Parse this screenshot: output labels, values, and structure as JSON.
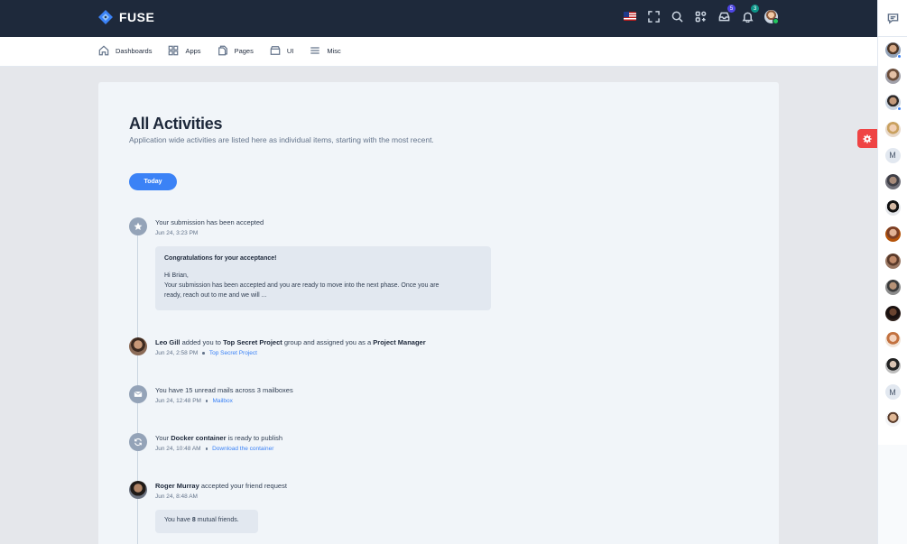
{
  "app": {
    "name": "FUSE"
  },
  "header": {
    "notifications_badge": "5",
    "alerts_badge": "3"
  },
  "nav": {
    "items": [
      {
        "label": "Dashboards",
        "icon": "home-icon"
      },
      {
        "label": "Apps",
        "icon": "grid-icon"
      },
      {
        "label": "Pages",
        "icon": "pages-icon"
      },
      {
        "label": "UI",
        "icon": "package-icon"
      },
      {
        "label": "Misc",
        "icon": "menu-icon"
      }
    ]
  },
  "main": {
    "title": "All Activities",
    "subtitle": "Application wide activities are listed here as individual items, starting with the most recent.",
    "filter_label": "Today"
  },
  "activities": [
    {
      "text": "Your submission has been accepted",
      "time": "Jun 24, 3:23 PM",
      "icon": "star-icon",
      "message": {
        "title": "Congratulations for your acceptance!",
        "greeting": "Hi Brian,",
        "line1": "Your submission has been accepted and you are ready to move into the next phase. Once you are",
        "line2": "ready, reach out to me and we will ..."
      }
    },
    {
      "actor": "Leo Gill",
      "text_a": " added you to ",
      "group": "Top Secret Project",
      "text_b": " group and assigned you as a ",
      "role": "Project Manager",
      "time": "Jun 24, 2:58 PM",
      "link": "Top Secret Project"
    },
    {
      "text": "You have 15 unread mails across 3 mailboxes",
      "time": "Jun 24, 12:48 PM",
      "link": "Mailbox",
      "icon": "mail-icon"
    },
    {
      "text_a": "Your ",
      "bold": "Docker container",
      "text_b": " is ready to publish",
      "time": "Jun 24, 10:48 AM",
      "link": "Download the container",
      "icon": "refresh-icon"
    },
    {
      "actor": "Roger Murray",
      "text": " accepted your friend request",
      "time": "Jun 24, 8:48 AM",
      "note_a": "You have ",
      "note_count": "8",
      "note_b": " mutual friends."
    }
  ],
  "contacts": {
    "initial_1": "M",
    "initial_2": "M"
  },
  "colors": {
    "header_bg": "#1e293b",
    "accent": "#3b82f6",
    "settings_tab": "#ef4444"
  }
}
